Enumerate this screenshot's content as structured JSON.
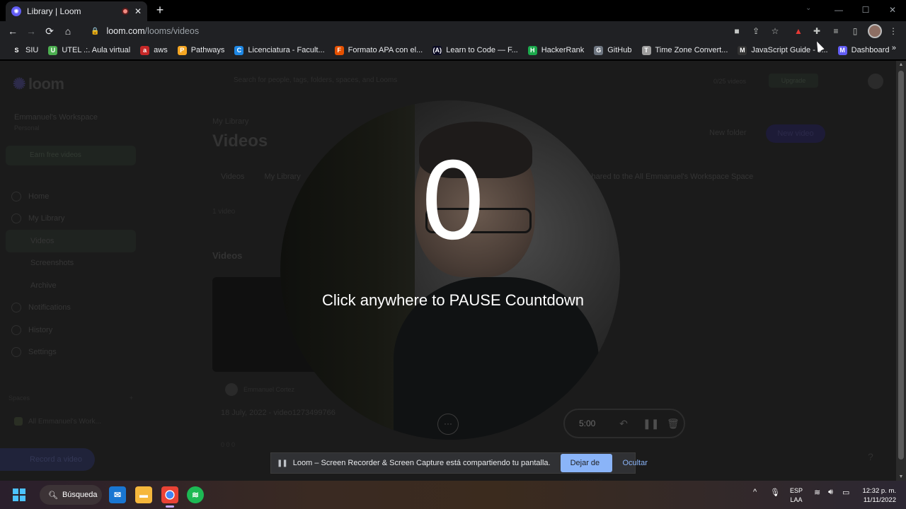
{
  "browser": {
    "tab": {
      "title": "Library | Loom",
      "favicon": "loom-icon",
      "recording_indicator": "record-icon"
    },
    "new_tab": "+",
    "url_host": "loom.com",
    "url_path": "/looms/videos",
    "nav": {
      "back": "←",
      "forward": "→",
      "reload": "⟳",
      "home": "⌂"
    },
    "window_controls": {
      "minimize": "—",
      "maximize": "☐",
      "close": "✕",
      "tab_search": "⌄"
    },
    "extensions": [
      "camera-icon",
      "share-icon",
      "star-icon",
      "pdf-icon",
      "puzzle-icon",
      "media-icon",
      "sidebar-icon",
      "menu-icon"
    ],
    "bookmarks": [
      {
        "label": "SIU",
        "icon": "S",
        "color": "#202124"
      },
      {
        "label": "UTEL .:. Aula virtual",
        "icon": "U",
        "color": "#4caf50"
      },
      {
        "label": "aws",
        "icon": "a",
        "color": "#c62828"
      },
      {
        "label": "Pathways",
        "icon": "P",
        "color": "#f5a623"
      },
      {
        "label": "Licenciatura - Facult...",
        "icon": "C",
        "color": "#1e88e5"
      },
      {
        "label": "Formato APA con el...",
        "icon": "F",
        "color": "#e65100"
      },
      {
        "label": "Learn to Code — F...",
        "icon": "(A)",
        "color": "#0a0a23"
      },
      {
        "label": "HackerRank",
        "icon": "H",
        "color": "#1ba94c"
      },
      {
        "label": "GitHub",
        "icon": "G",
        "color": "#6e7681"
      },
      {
        "label": "Time Zone Convert...",
        "icon": "T",
        "color": "#9e9e9e"
      },
      {
        "label": "JavaScript Guide - J...",
        "icon": "M",
        "color": "#333"
      },
      {
        "label": "Dashboard",
        "icon": "M",
        "color": "#625df5"
      }
    ],
    "bookmarks_more": "»"
  },
  "loom": {
    "logo": "loom",
    "workspace": {
      "name": "Emmanuel's Workspace",
      "plan": "Personal"
    },
    "trial_banner": "Earn free videos",
    "nav": [
      "Home",
      "My Library",
      "Videos",
      "Screenshots",
      "Archive",
      "Notifications",
      "History",
      "Settings"
    ],
    "spaces_label": "Spaces",
    "spaces_add": "+",
    "space_item": "All Emmanuel's Work...",
    "record_button": "Record a video",
    "search_placeholder": "Search for people, tags, folders, spaces, and Looms",
    "upgrade_text": "0/25 videos",
    "upgrade_button": "Upgrade",
    "breadcrumb": "My Library",
    "page_title": "Videos",
    "new_folder": "New folder",
    "new_video": "New video",
    "tabs": [
      "Videos",
      "My Library"
    ],
    "shared_message": "shared to the All Emmanuel's Workspace Space",
    "video_count": "1 video",
    "section_title": "Videos",
    "video_owner": "Emmanuel Cortez",
    "video_title": "18 July, 2022 - video1273499766",
    "video_stats": "0   0   0",
    "help": "?"
  },
  "recording": {
    "countdown": "0",
    "instruction": "Click anywhere to PAUSE Countdown",
    "more": "···",
    "timer": "5:00",
    "undo": "↶",
    "pause": "❚❚",
    "delete": "🗑"
  },
  "share_notice": {
    "pause_icon": "❚❚",
    "message": "Loom – Screen Recorder & Screen Capture está compartiendo tu pantalla.",
    "stop_button": "Dejar de compartir",
    "hide_button": "Ocultar"
  },
  "taskbar": {
    "search_label": "Búsqueda",
    "apps": [
      "mail-icon",
      "file-explorer-icon",
      "chrome-icon",
      "spotify-icon"
    ],
    "tray": {
      "chevron": "^",
      "mic": "mic-icon",
      "lang_top": "ESP",
      "lang_bottom": "LAA",
      "wifi": "wifi-icon",
      "volume": "volume-icon",
      "battery": "battery-icon"
    },
    "time": "12:32 p. m.",
    "date": "11/11/2022"
  }
}
